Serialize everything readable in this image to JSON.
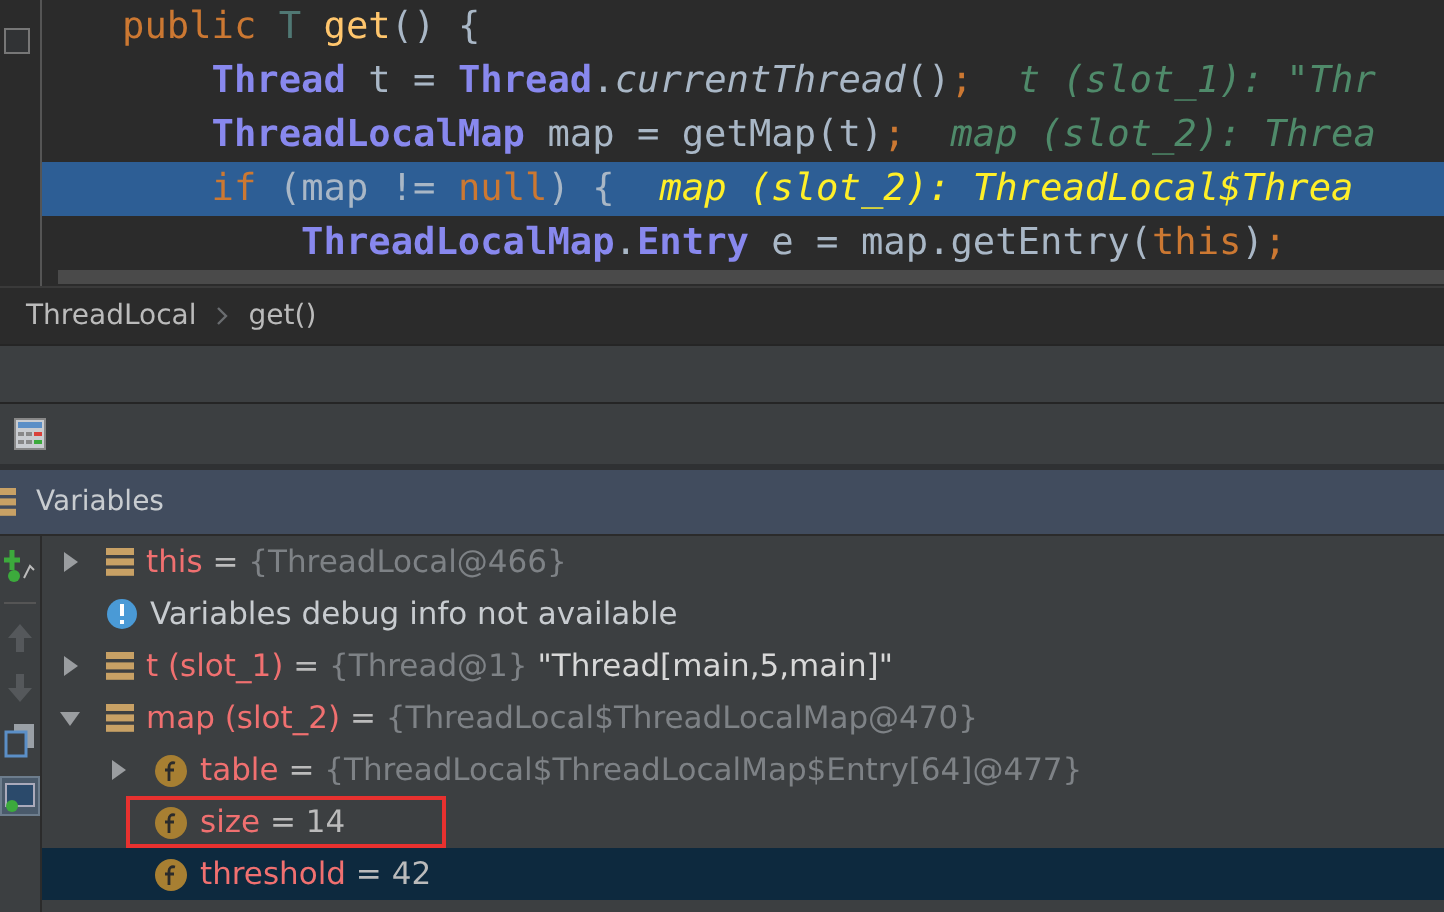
{
  "editor": {
    "lines": [
      {
        "current": false,
        "tokens": [
          {
            "kind": "keyword",
            "text": "public "
          },
          {
            "kind": "generic",
            "text": "T "
          },
          {
            "kind": "method",
            "text": "get"
          },
          {
            "kind": "plain",
            "text": "() {"
          }
        ]
      },
      {
        "current": false,
        "tokens": [
          {
            "kind": "type",
            "text": "    Thread"
          },
          {
            "kind": "plain",
            "text": " t = "
          },
          {
            "kind": "type",
            "text": "Thread"
          },
          {
            "kind": "plain",
            "text": "."
          },
          {
            "kind": "static",
            "text": "currentThread"
          },
          {
            "kind": "plain",
            "text": "()"
          },
          {
            "kind": "keyword",
            "text": ";"
          },
          {
            "kind": "hint",
            "text": "  t (slot_1): \"Thr"
          }
        ]
      },
      {
        "current": false,
        "tokens": [
          {
            "kind": "type",
            "text": "    ThreadLocalMap"
          },
          {
            "kind": "plain",
            "text": " map = getMap(t)"
          },
          {
            "kind": "keyword",
            "text": ";"
          },
          {
            "kind": "hint",
            "text": "  map (slot_2): Threa"
          }
        ]
      },
      {
        "current": true,
        "tokens": [
          {
            "kind": "keyword",
            "text": "    if "
          },
          {
            "kind": "plain",
            "text": "(map != "
          },
          {
            "kind": "keyword",
            "text": "null"
          },
          {
            "kind": "plain",
            "text": ") {"
          },
          {
            "kind": "hint",
            "text": "  map (slot_2): ThreadLocal$Threa"
          }
        ]
      },
      {
        "current": false,
        "tokens": [
          {
            "kind": "type",
            "text": "        ThreadLocalMap"
          },
          {
            "kind": "plain",
            "text": "."
          },
          {
            "kind": "type",
            "text": "Entry"
          },
          {
            "kind": "plain",
            "text": " e = map.getEntry("
          },
          {
            "kind": "keyword",
            "text": "this"
          },
          {
            "kind": "plain",
            "text": ")"
          },
          {
            "kind": "keyword",
            "text": ";"
          }
        ]
      }
    ]
  },
  "breadcrumbs": [
    {
      "label": "ThreadLocal"
    },
    {
      "label": "get()"
    }
  ],
  "variables_panel": {
    "title": "Variables",
    "items": [
      {
        "kind": "object",
        "expanded": false,
        "selected": false,
        "annotated": false,
        "name": "this",
        "separator": " = ",
        "value": "{ThreadLocal@466}"
      },
      {
        "kind": "info",
        "selected": false,
        "annotated": false,
        "message": "Variables debug info not available"
      },
      {
        "kind": "object",
        "expanded": false,
        "selected": false,
        "annotated": false,
        "name": "t (slot_1)",
        "separator": " = ",
        "value": "{Thread@1}",
        "string": " \"Thread[main,5,main]\""
      },
      {
        "kind": "object",
        "expanded": true,
        "selected": false,
        "annotated": false,
        "name": "map (slot_2)",
        "separator": " = ",
        "value": "{ThreadLocal$ThreadLocalMap@470}",
        "children": [
          {
            "kind": "field",
            "expanded": false,
            "selected": false,
            "annotated": false,
            "name": "table",
            "separator": " = ",
            "value": "{ThreadLocal$ThreadLocalMap$Entry[64]@477}"
          },
          {
            "kind": "field",
            "selected": false,
            "annotated": true,
            "name": "size",
            "separator": " = ",
            "number": "14"
          },
          {
            "kind": "field",
            "selected": true,
            "annotated": false,
            "name": "threshold",
            "separator": " = ",
            "number": "42"
          }
        ]
      }
    ]
  }
}
